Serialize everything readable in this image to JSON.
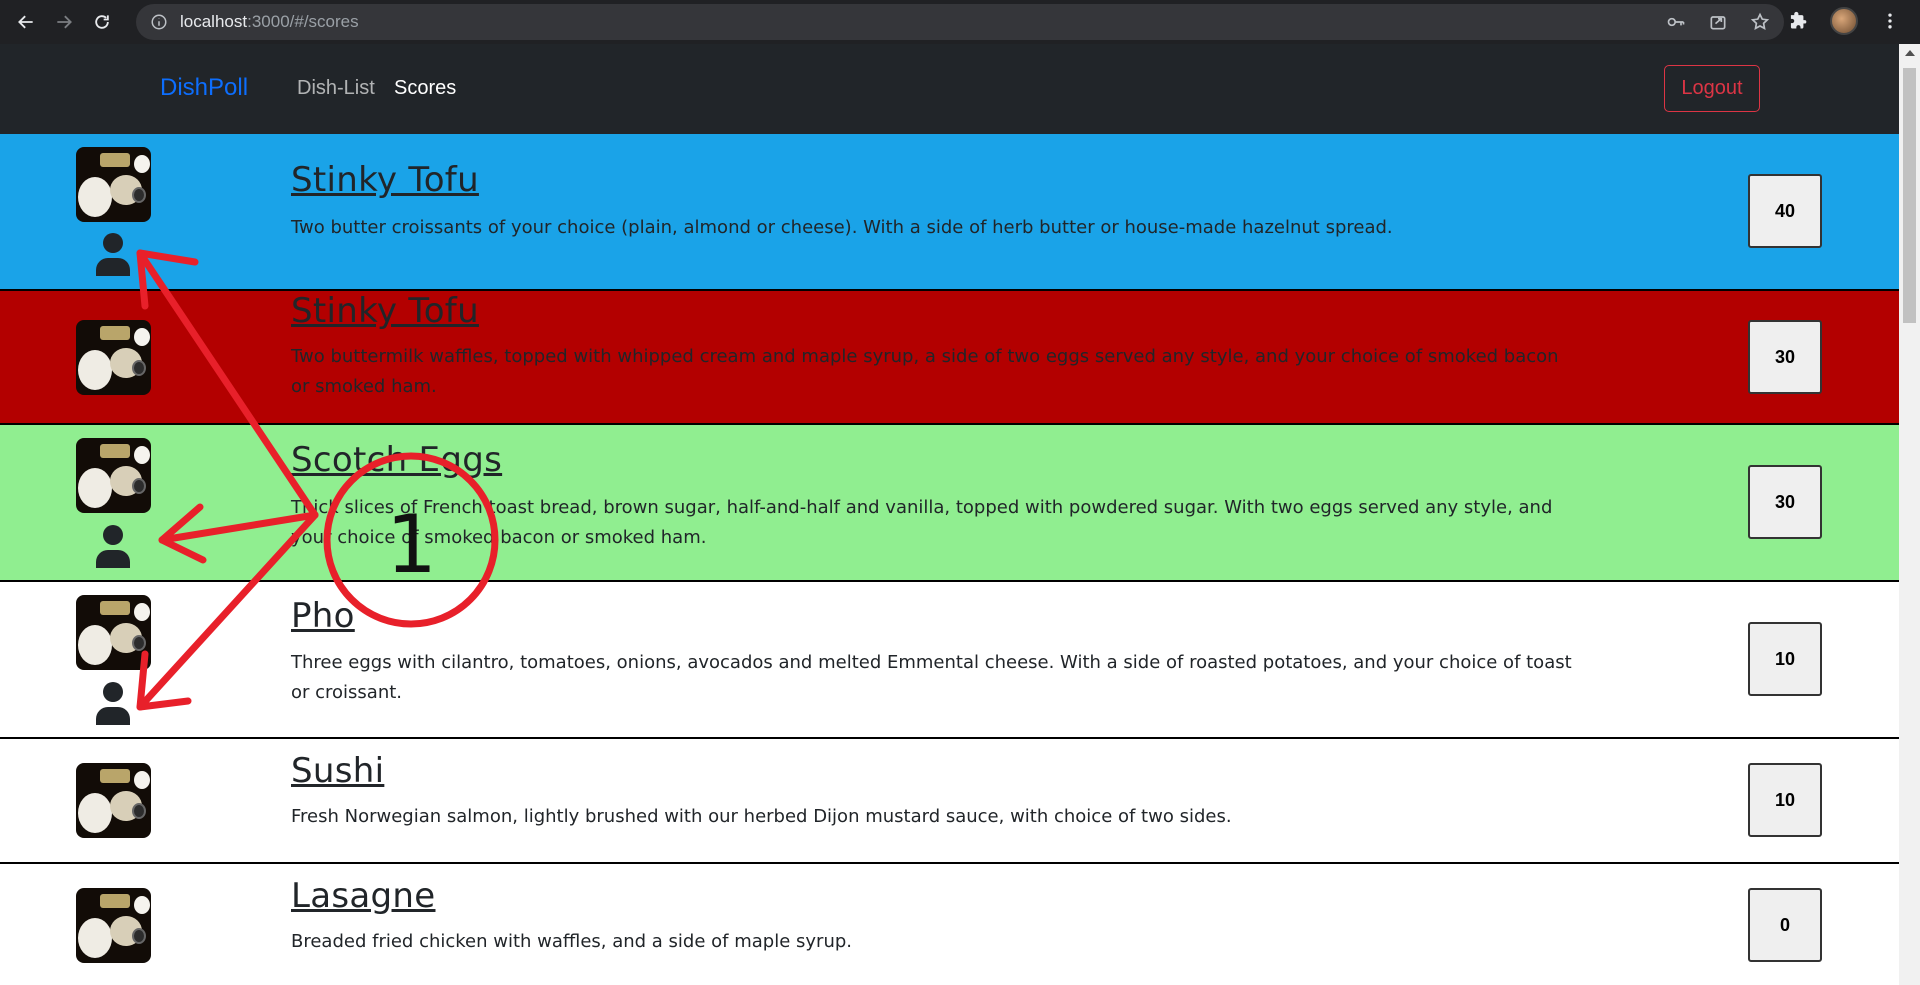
{
  "browser": {
    "url_host": "localhost",
    "url_path": ":3000/#/scores"
  },
  "navbar": {
    "brand": "DishPoll",
    "links": [
      {
        "label": "Dish-List",
        "active": false
      },
      {
        "label": "Scores",
        "active": true
      }
    ],
    "logout_label": "Logout"
  },
  "dishes": [
    {
      "title": "Stinky Tofu",
      "description": "Two butter croissants of your choice (plain, almond or cheese). With a side of herb butter or house-made hazelnut spread.",
      "score": "40",
      "row_color": "#1aa3e8",
      "has_user_icon": true
    },
    {
      "title": "Stinky Tofu",
      "description": "Two buttermilk waffles, topped with whipped cream and maple syrup, a side of two eggs served any style, and your choice of smoked bacon or smoked ham.",
      "score": "30",
      "row_color": "#b30000",
      "has_user_icon": false
    },
    {
      "title": "Scotch Eggs",
      "description": "Thick slices of French toast bread, brown sugar, half-and-half and vanilla, topped with powdered sugar. With two eggs served any style, and your choice of smoked bacon or smoked ham.",
      "score": "30",
      "row_color": "#90ee90",
      "has_user_icon": true
    },
    {
      "title": "Pho",
      "description": "Three eggs with cilantro, tomatoes, onions, avocados and melted Emmental cheese. With a side of roasted potatoes, and your choice of toast or croissant.",
      "score": "10",
      "row_color": "#ffffff",
      "has_user_icon": true
    },
    {
      "title": "Sushi",
      "description": "Fresh Norwegian salmon, lightly brushed with our herbed Dijon mustard sauce, with choice of two sides.",
      "score": "10",
      "row_color": "#ffffff",
      "has_user_icon": false
    },
    {
      "title": "Lasagne",
      "description": "Breaded fried chicken with waffles, and a side of maple syrup.",
      "score": "0",
      "row_color": "#ffffff",
      "has_user_icon": false
    }
  ],
  "annotation": {
    "label": "1",
    "color": "#e8202a"
  }
}
